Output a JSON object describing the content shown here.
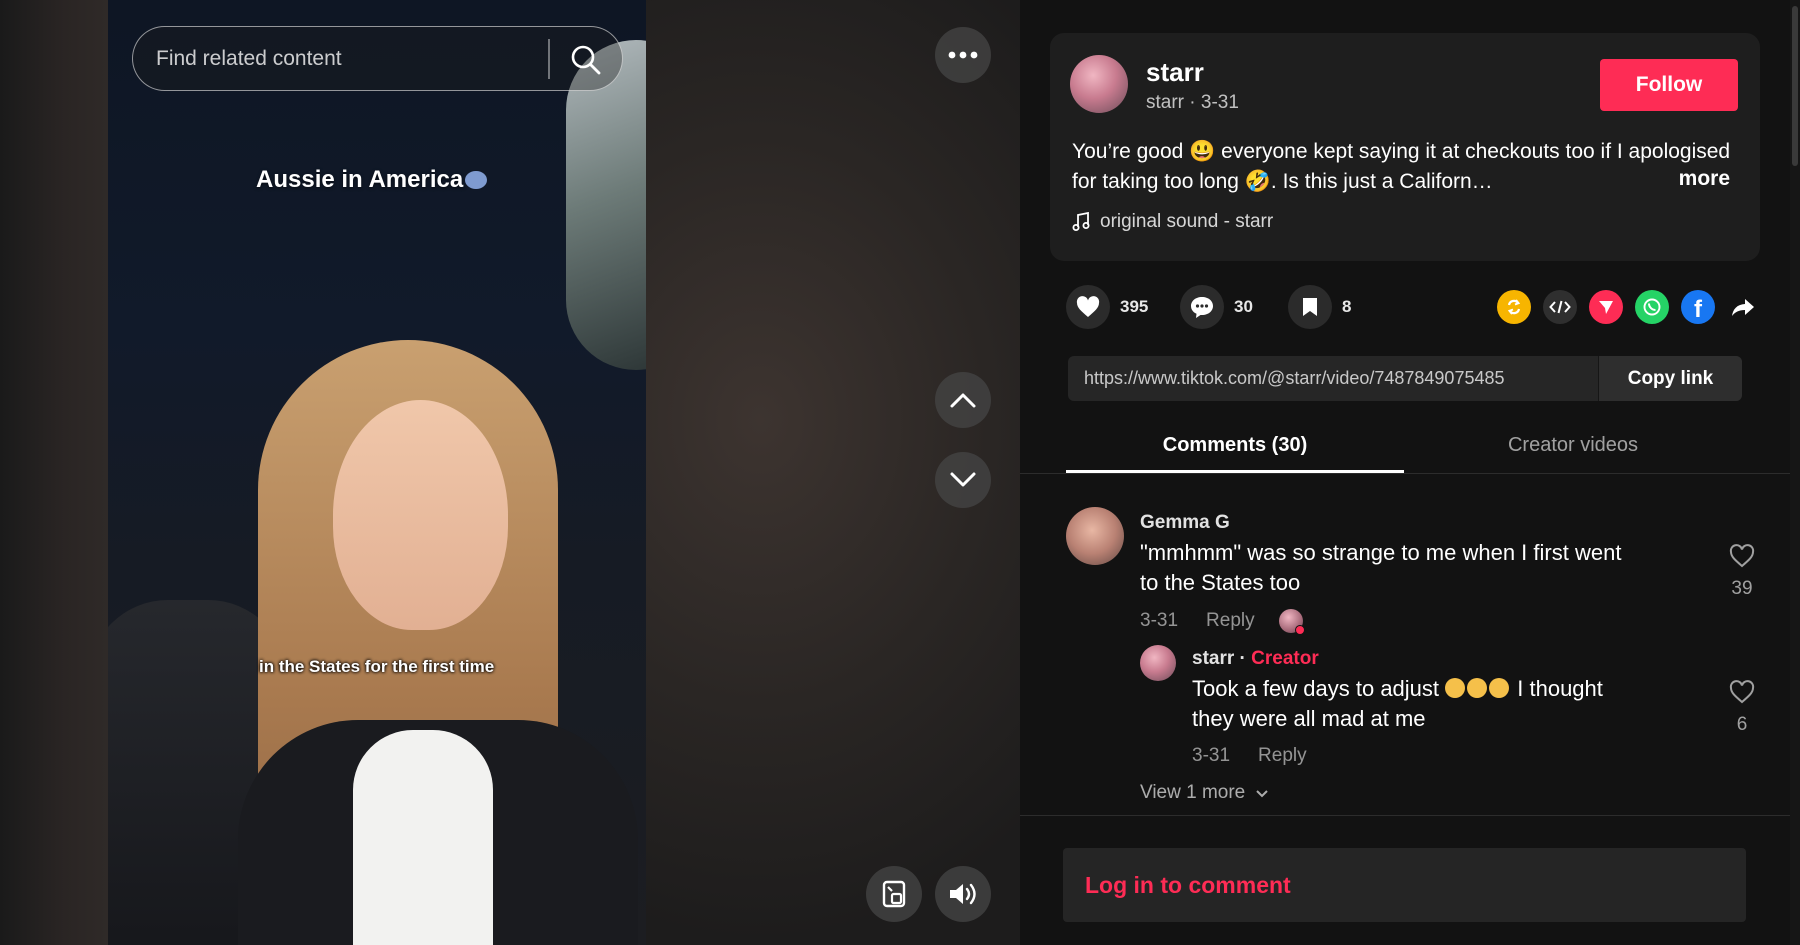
{
  "search": {
    "placeholder": "Find related content"
  },
  "video": {
    "caption_title": "Aussie in America",
    "subtitle": "in the States for the first time"
  },
  "author": {
    "name": "starr",
    "handle": "starr",
    "date": "3-31",
    "follow_label": "Follow",
    "description": "You’re good 😃 everyone kept saying it at checkouts too if I apologised for taking too long 🤣. Is this just a Californ…",
    "more_label": "more",
    "sound": "original sound - starr"
  },
  "actions": {
    "likes": "395",
    "comments": "30",
    "saves": "8"
  },
  "share_icons": [
    "repost-icon",
    "embed-icon",
    "send-icon",
    "whatsapp-icon",
    "facebook-icon",
    "share-arrow-icon"
  ],
  "link": {
    "url": "https://www.tiktok.com/@starr/video/7487849075485",
    "copy_label": "Copy link"
  },
  "tabs": {
    "comments": "Comments (30)",
    "creator_videos": "Creator videos"
  },
  "comments": [
    {
      "user": "Gemma G",
      "text_line1": "\"mmhmm\" was so strange to me when I first went",
      "text_line2": "to the States too",
      "date": "3-31",
      "reply_label": "Reply",
      "likes": "39"
    }
  ],
  "reply": {
    "user": "starr",
    "separator": " · ",
    "badge": "Creator",
    "text_line1": "Took a few days to adjust",
    "text_line1_after": " I thought",
    "text_line2": "they were all mad at me",
    "date": "3-31",
    "reply_label": "Reply",
    "likes": "6"
  },
  "view_more": "View 1 more",
  "login_prompt": "Log in to comment",
  "colors": {
    "accent": "#fe2c55",
    "panel": "#121212",
    "card": "#1e1e1e"
  }
}
